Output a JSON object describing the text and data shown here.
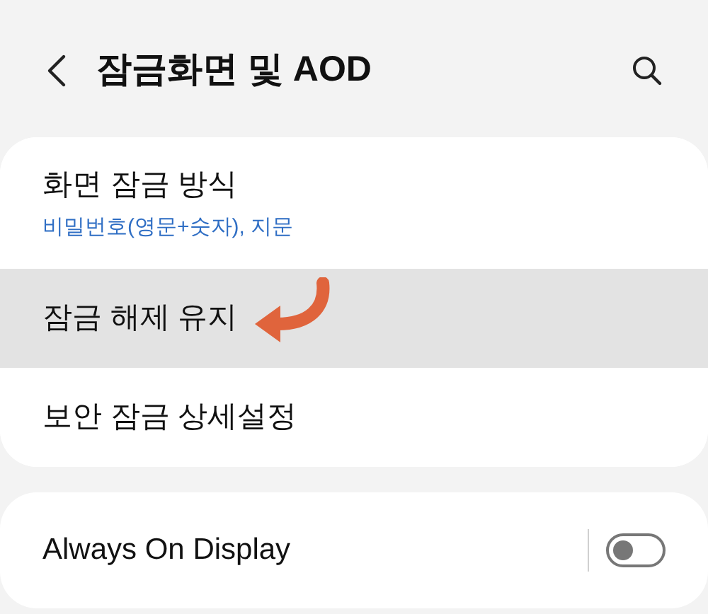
{
  "header": {
    "title": "잠금화면 및 AOD"
  },
  "settings": [
    {
      "title": "화면 잠금 방식",
      "subtitle": "비밀번호(영문+숫자), 지문",
      "highlighted": false
    },
    {
      "title": "잠금 해제 유지",
      "highlighted": true
    },
    {
      "title": "보안 잠금 상세설정",
      "highlighted": false
    }
  ],
  "aod": {
    "title": "Always On Display",
    "on": false
  }
}
